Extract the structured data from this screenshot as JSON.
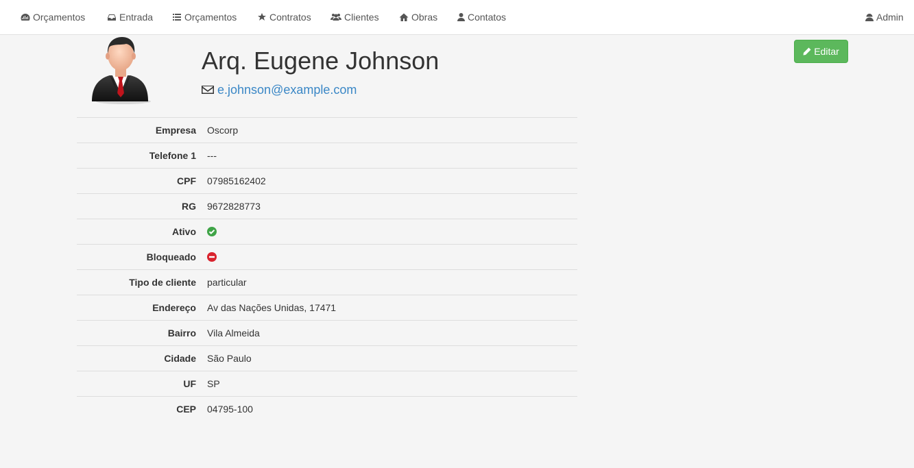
{
  "nav": {
    "items": [
      {
        "label": "Orçamentos",
        "icon": "dashboard-icon"
      },
      {
        "label": "Entrada",
        "icon": "inbox-icon"
      },
      {
        "label": "Orçamentos",
        "icon": "list-icon"
      },
      {
        "label": "Contratos",
        "icon": "star-icon"
      },
      {
        "label": "Clientes",
        "icon": "users-icon"
      },
      {
        "label": "Obras",
        "icon": "home-icon"
      },
      {
        "label": "Contatos",
        "icon": "user-icon"
      }
    ],
    "user": {
      "label": "Admin",
      "icon": "user-secret-icon"
    }
  },
  "profile": {
    "name": "Arq. Eugene Johnson",
    "email": "e.johnson@example.com",
    "edit_label": "Editar"
  },
  "details": [
    {
      "label": "Empresa",
      "value": "Oscorp"
    },
    {
      "label": "Telefone 1",
      "value": "---"
    },
    {
      "label": "CPF",
      "value": "07985162402"
    },
    {
      "label": "RG",
      "value": "9672828773"
    },
    {
      "label": "Ativo",
      "status": "check-circle-icon"
    },
    {
      "label": "Bloqueado",
      "status": "minus-circle-icon"
    },
    {
      "label": "Tipo de cliente",
      "value": "particular"
    },
    {
      "label": "Endereço",
      "value": "Av das Nações Unidas, 17471"
    },
    {
      "label": "Bairro",
      "value": "Vila Almeida"
    },
    {
      "label": "Cidade",
      "value": "São Paulo"
    },
    {
      "label": "UF",
      "value": "SP"
    },
    {
      "label": "CEP",
      "value": "04795-100"
    }
  ],
  "colors": {
    "success": "#5cb85c",
    "danger": "#d9232e",
    "link": "#3a87c6"
  }
}
